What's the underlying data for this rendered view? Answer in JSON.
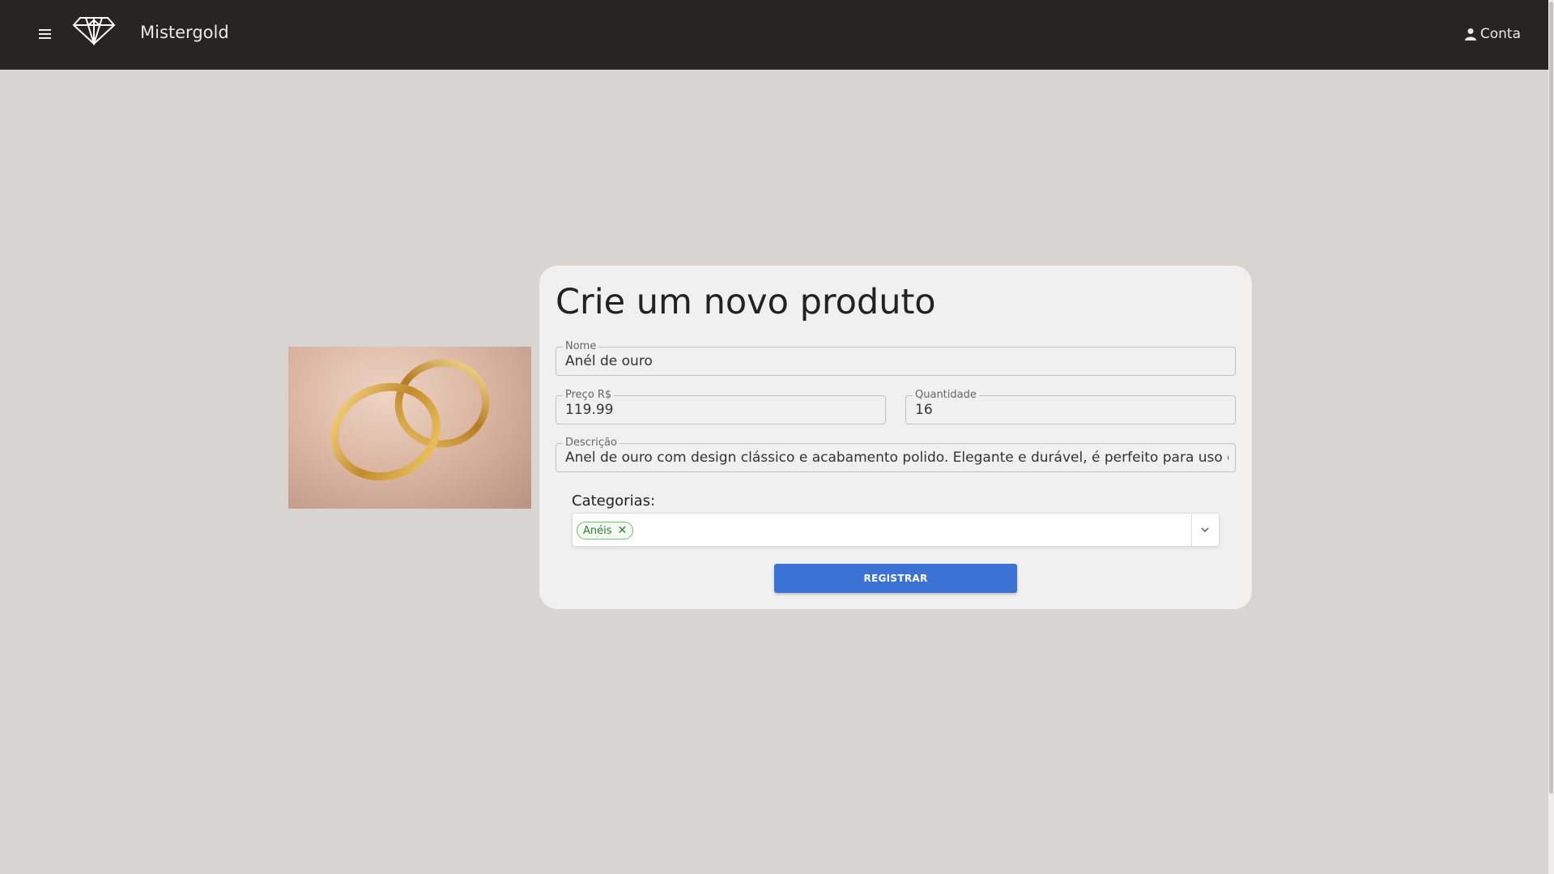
{
  "navbar": {
    "brand": "Mistergold",
    "account_label": "Conta",
    "background": "#282424"
  },
  "form": {
    "title": "Crie um novo produto",
    "fields": {
      "name": {
        "label": "Nome",
        "value": "Anél de ouro"
      },
      "price": {
        "label": "Preço R$",
        "value": "119.99"
      },
      "quantity": {
        "label": "Quantidade",
        "value": "16"
      },
      "description": {
        "label": "Descrição",
        "value": "Anel de ouro com design clássico e acabamento polido. Elegante e durável, é perfeito para uso diário"
      }
    },
    "categories": {
      "label": "Categorias:",
      "selected": [
        "Anéis"
      ]
    },
    "submit_label": "REGISTRAR",
    "accent": "#3b72d3"
  },
  "icons": {
    "menu": "hamburger-icon",
    "logo": "diamond-logo-icon",
    "account": "user-icon",
    "chip_remove": "close-icon",
    "select": "chevron-down-icon"
  }
}
